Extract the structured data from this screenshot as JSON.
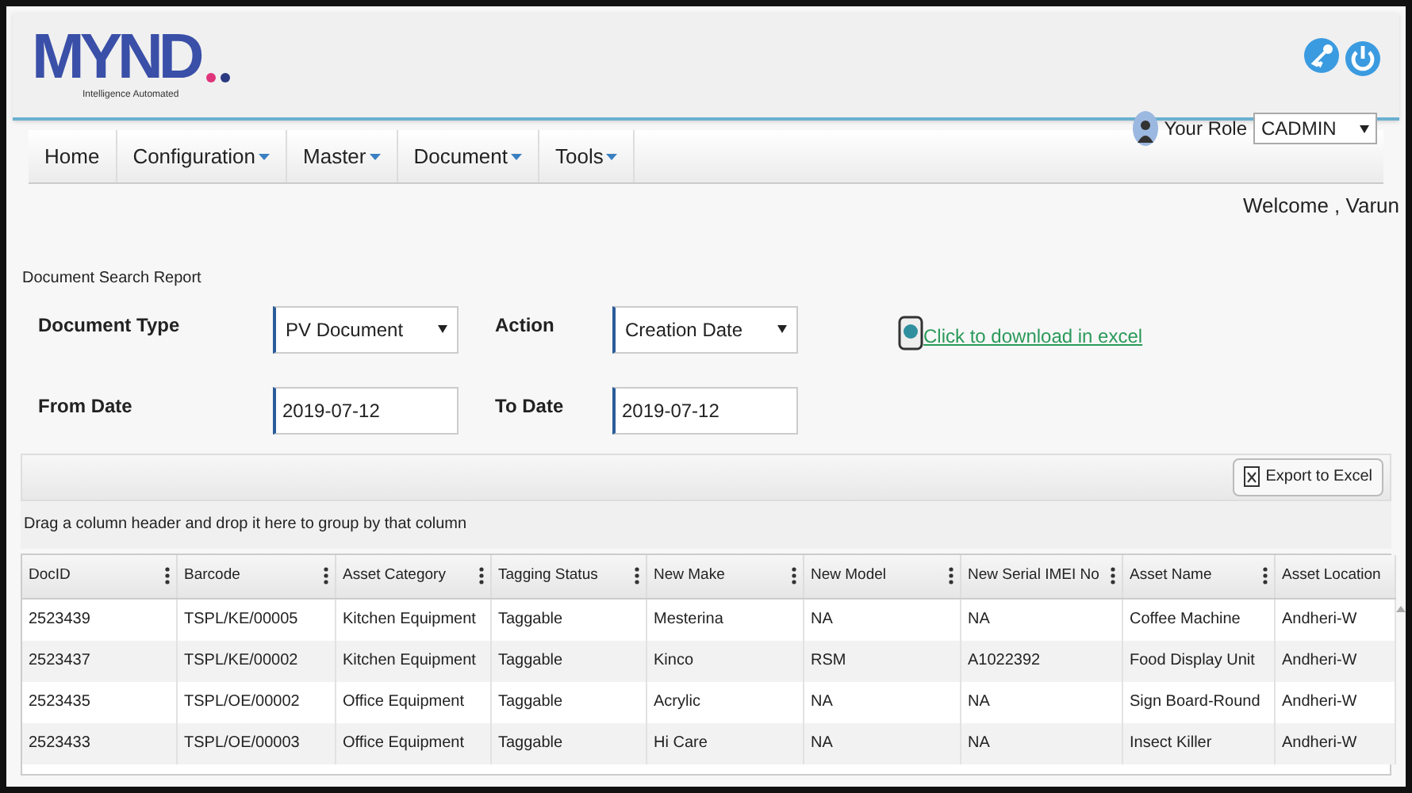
{
  "logo": {
    "wordmark": "MYND",
    "tagline": "Intelligence Automated"
  },
  "header_actions": [
    {
      "kind": "key"
    },
    {
      "kind": "power"
    }
  ],
  "menu": [
    {
      "label": "Home",
      "caret": false
    },
    {
      "label": "Configuration",
      "caret": true
    },
    {
      "label": "Master",
      "caret": true
    },
    {
      "label": "Document",
      "caret": true
    },
    {
      "label": "Tools",
      "caret": true
    }
  ],
  "role": {
    "label": "Your Role",
    "value": "CADMIN"
  },
  "welcome": "Welcome , Varun",
  "report_title": "Document Search Report",
  "filters": [
    {
      "label": "Document Type",
      "kind": "select",
      "value": "PV Document"
    },
    {
      "label": "Action",
      "kind": "select",
      "value": "Creation Date"
    },
    {
      "label": "From Date",
      "kind": "input",
      "value": "2019-07-12"
    },
    {
      "label": "To Date",
      "kind": "input",
      "value": "2019-07-12"
    }
  ],
  "download_link": "Click to download in excel",
  "export_button": "Export to Excel",
  "group_hint": "Drag a column header and drop it here to group by that column",
  "table": {
    "columns": [
      "DocID",
      "Barcode",
      "Asset Category",
      "Tagging Status",
      "New Make",
      "New Model",
      "New Serial IMEI No",
      "Asset Name",
      "Asset Location"
    ],
    "rows": [
      [
        "2523439",
        "TSPL/KE/00005",
        "Kitchen Equipment",
        "Taggable",
        "Mesterina",
        "NA",
        "NA",
        "Coffee Machine",
        "Andheri-W"
      ],
      [
        "2523437",
        "TSPL/KE/00002",
        "Kitchen Equipment",
        "Taggable",
        "Kinco",
        "RSM",
        "A1022392",
        "Food Display Unit",
        "Andheri-W"
      ],
      [
        "2523435",
        "TSPL/OE/00002",
        "Office Equipment",
        "Taggable",
        "Acrylic",
        "NA",
        "NA",
        "Sign Board-Round",
        "Andheri-W"
      ],
      [
        "2523433",
        "TSPL/OE/00003",
        "Office Equipment",
        "Taggable",
        "Hi Care",
        "NA",
        "NA",
        "Insect Killer",
        "Andheri-W"
      ]
    ]
  }
}
